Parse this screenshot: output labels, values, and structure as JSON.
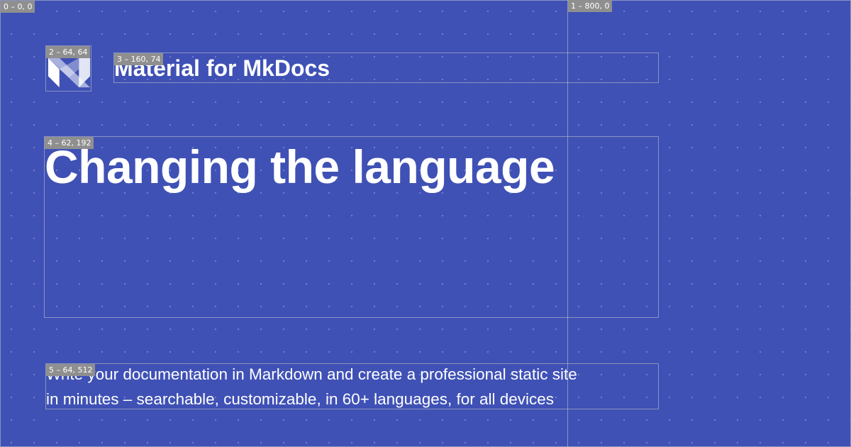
{
  "boxes": {
    "b0": "0 – 0, 0",
    "b1": "1 – 800, 0",
    "b2": "2 – 64, 64",
    "b3": "3 – 160, 74",
    "b4": "4 – 62, 192",
    "b5": "5 – 64, 512"
  },
  "site_name": "Material for MkDocs",
  "page_title": "Changing the language",
  "description": {
    "line1": "Write your documentation in Markdown and create a professional static site",
    "line2": "in minutes – searchable, customizable, in 60+ languages, for all devices"
  },
  "colors": {
    "background": "#3f51b5",
    "text": "#ffffff",
    "label_bg": "#8f8f8f"
  }
}
